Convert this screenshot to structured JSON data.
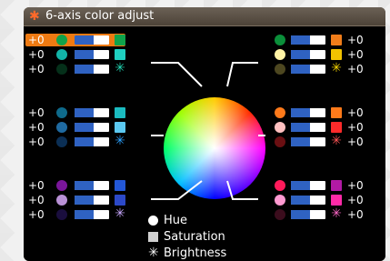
{
  "window": {
    "title": "6-axis color adjust",
    "icon": "color-wheel-icon"
  },
  "rows": [
    {
      "side": "left",
      "value": "+0",
      "hue_color": "#0fa34b",
      "sat_color": "#0fa34b",
      "bri_color": "#0fa34b",
      "selected": true
    },
    {
      "side": "left",
      "value": "+0",
      "hue_color": "#12b3a7",
      "sat_color": "#1fd0c0",
      "bri_color": "#0b6e2f"
    },
    {
      "side": "left",
      "value": "+0",
      "hue_color": "#05301a",
      "sat_color": "#1c6e38",
      "bri_color": "#22d9b5"
    },
    {
      "side": "left",
      "value": "+0",
      "hue_color": "#0e6a8b",
      "sat_color": "#1bbbc0",
      "bri_color": "#0e7a96"
    },
    {
      "side": "left",
      "value": "+0",
      "hue_color": "#1f6aa1",
      "sat_color": "#5bc8f0",
      "bri_color": "#1f86c8"
    },
    {
      "side": "left",
      "value": "+0",
      "hue_color": "#0b2f55",
      "sat_color": "#1f6ed3",
      "bri_color": "#2aa1ff"
    },
    {
      "side": "left",
      "value": "+0",
      "hue_color": "#7a169a",
      "sat_color": "#2357d6",
      "bri_color": "#2a3fc6"
    },
    {
      "side": "left",
      "value": "+0",
      "hue_color": "#b991d6",
      "sat_color": "#2c49c8",
      "bri_color": "#151f8c"
    },
    {
      "side": "left",
      "value": "+0",
      "hue_color": "#1a0e3e",
      "sat_color": "#2a2a9a",
      "bri_color": "#c9a8ff"
    },
    {
      "side": "right",
      "value": "+0",
      "hue_color": "#0b8f3a",
      "sat_color": "#f07d1a",
      "bri_color": "#f07d1a"
    },
    {
      "side": "right",
      "value": "+0",
      "hue_color": "#fff3a5",
      "sat_color": "#f2c200",
      "bri_color": "#f2c200"
    },
    {
      "side": "right",
      "value": "+0",
      "hue_color": "#4d4720",
      "sat_color": "#d0c200",
      "bri_color": "#f6d400"
    },
    {
      "side": "right",
      "value": "+0",
      "hue_color": "#ff7a1a",
      "sat_color": "#ff7a1a",
      "bri_color": "#ff7a1a"
    },
    {
      "side": "right",
      "value": "+0",
      "hue_color": "#ffc0c0",
      "sat_color": "#ff2a2a",
      "bri_color": "#ff2a2a"
    },
    {
      "side": "right",
      "value": "+0",
      "hue_color": "#6a0f12",
      "sat_color": "#c01b1b",
      "bri_color": "#ff5555"
    },
    {
      "side": "right",
      "value": "+0",
      "hue_color": "#ff1a5a",
      "sat_color": "#b21aa5",
      "bri_color": "#b21aa5"
    },
    {
      "side": "right",
      "value": "+0",
      "hue_color": "#ff9ad1",
      "sat_color": "#ff2aa8",
      "bri_color": "#ff2aa8"
    },
    {
      "side": "right",
      "value": "+0",
      "hue_color": "#3b0d1d",
      "sat_color": "#d0307a",
      "bri_color": "#ff66c6"
    }
  ],
  "legend": [
    {
      "type": "hue",
      "label": "Hue"
    },
    {
      "type": "saturation",
      "label": "Saturation"
    },
    {
      "type": "brightness",
      "label": "Brightness"
    }
  ],
  "slider_level": 0.55
}
